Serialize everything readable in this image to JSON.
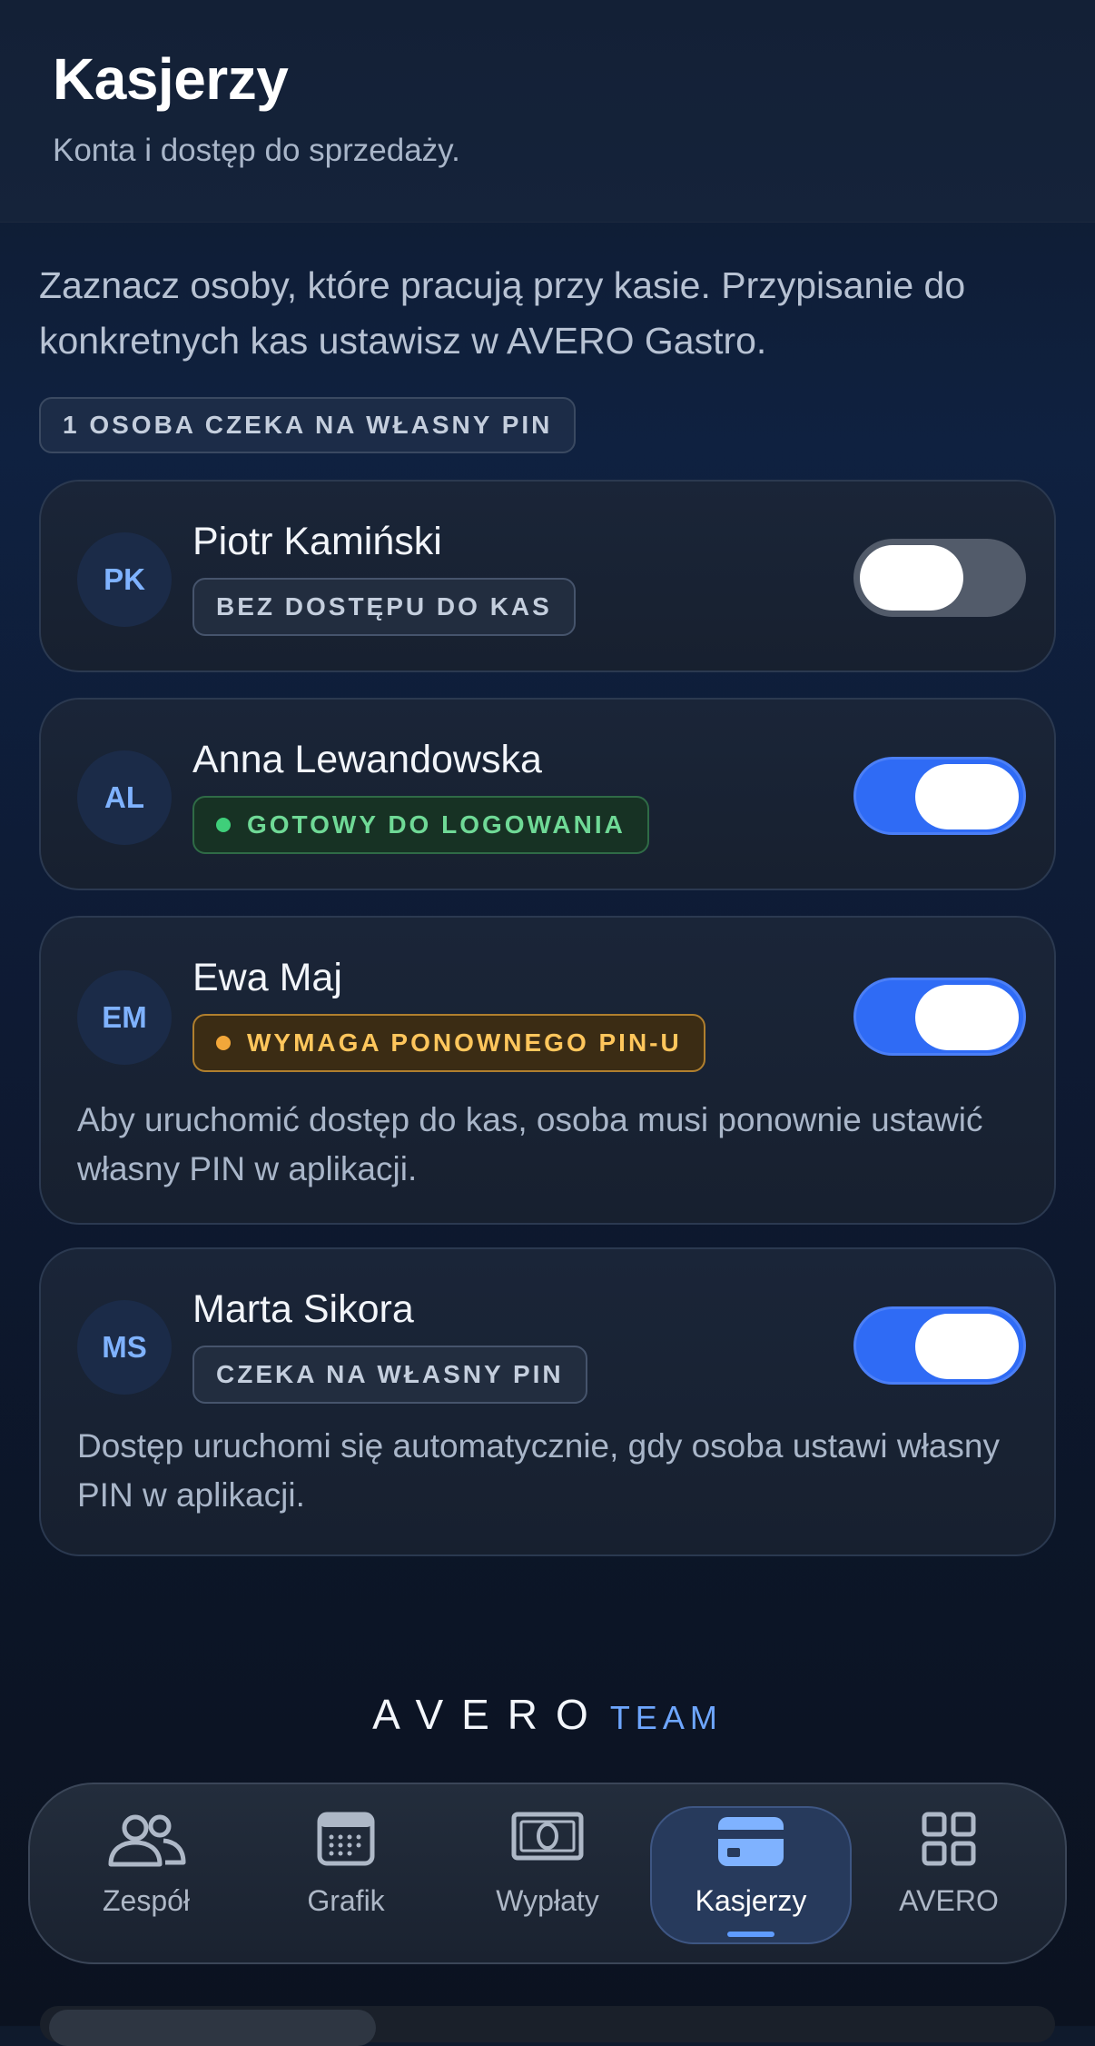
{
  "header": {
    "title": "Kasjerzy",
    "subtitle": "Konta i dostęp do sprzedaży."
  },
  "intro": "Zaznacz osoby, które pracują przy kasie. Przypisanie do konkretnych kas ustawisz w AVERO Gastro.",
  "pending_badge": "1 OSOBA CZEKA NA WŁASNY PIN",
  "cashiers": [
    {
      "initials": "PK",
      "name": "Piotr Kamiński",
      "status": "BEZ DOSTĘPU DO KAS",
      "status_kind": "neutral",
      "enabled": false,
      "note": ""
    },
    {
      "initials": "AL",
      "name": "Anna Lewandowska",
      "status": "GOTOWY DO LOGOWANIA",
      "status_kind": "green",
      "enabled": true,
      "note": ""
    },
    {
      "initials": "EM",
      "name": "Ewa Maj",
      "status": "WYMAGA PONOWNEGO PIN-U",
      "status_kind": "amber",
      "enabled": true,
      "note": "Aby uruchomić dostęp do kas, osoba musi ponownie ustawić własny PIN w aplikacji."
    },
    {
      "initials": "MS",
      "name": "Marta Sikora",
      "status": "CZEKA NA WŁASNY PIN",
      "status_kind": "neutral",
      "enabled": true,
      "note": "Dostęp uruchomi się automatycznie, gdy osoba ustawi własny PIN w aplikacji."
    }
  ],
  "brand": {
    "main": "AVERO",
    "sub": "TEAM"
  },
  "nav": {
    "active": "Kasjerzy",
    "items": [
      {
        "label": "Zespół",
        "icon": "users-icon"
      },
      {
        "label": "Grafik",
        "icon": "calendar-icon"
      },
      {
        "label": "Wypłaty",
        "icon": "banknote-icon"
      },
      {
        "label": "Kasjerzy",
        "icon": "card-icon"
      },
      {
        "label": "AVERO",
        "icon": "grid-icon"
      }
    ]
  },
  "colors": {
    "accent": "#2f6bf5",
    "ready": "#6fd996",
    "warning": "#ffc65c",
    "brand_sub": "#6ea6ff"
  }
}
